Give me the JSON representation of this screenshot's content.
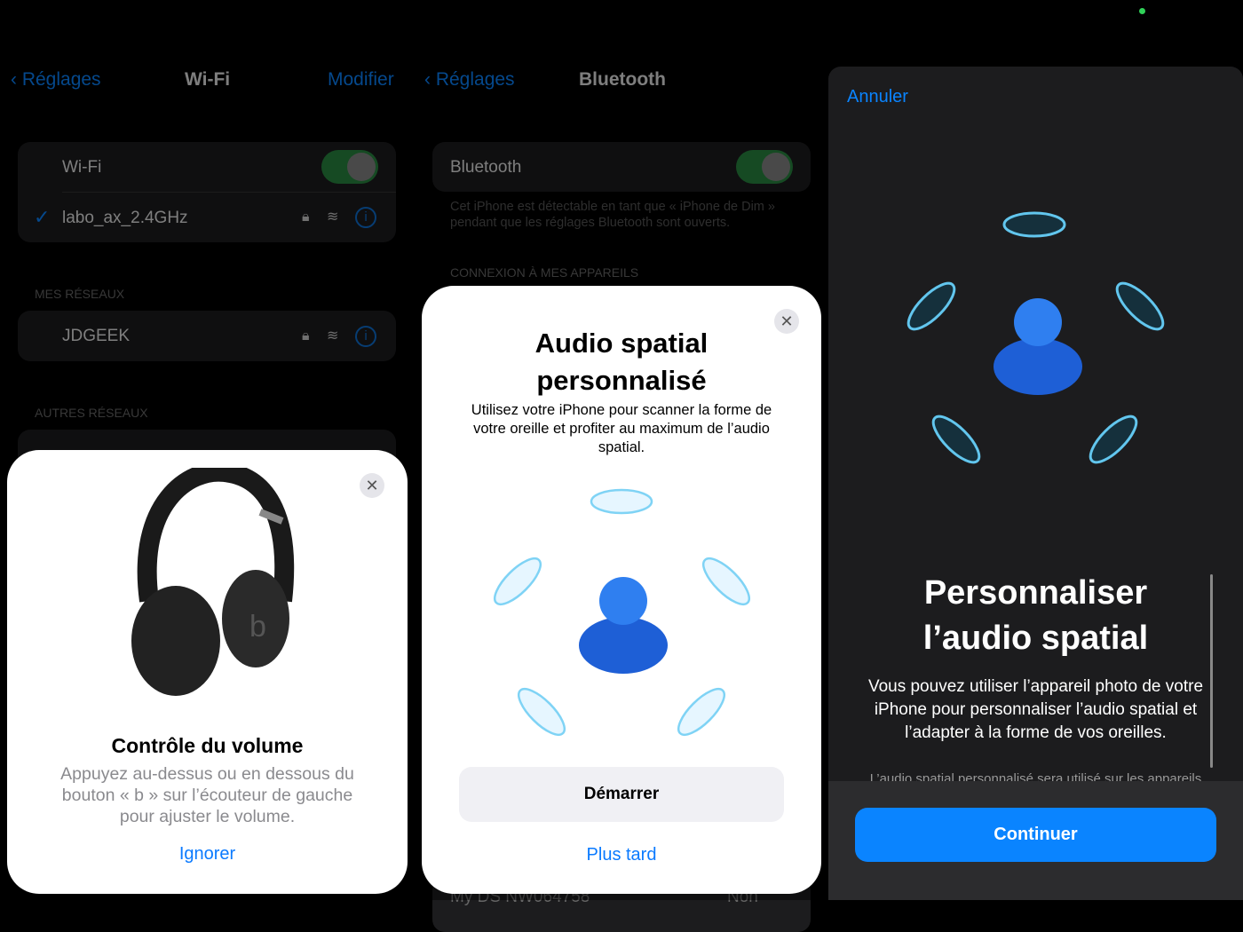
{
  "status": {
    "indicator_color": "#30d158"
  },
  "wifi_screen": {
    "back": "Réglages",
    "title": "Wi-Fi",
    "edit": "Modifier",
    "wifi_label": "Wi-Fi",
    "wifi_on": true,
    "connected": "labo_ax_2.4GHz",
    "my_networks_header": "MES RÉSEAUX",
    "my_networks": [
      "JDGEEK"
    ],
    "other_networks_header": "AUTRES RÉSEAUX"
  },
  "volume_card": {
    "title": "Contrôle du volume",
    "body": "Appuyez au-dessus ou en dessous du bouton « b » sur l’écouteur de gauche pour ajuster le volume.",
    "ignore": "Ignorer"
  },
  "bt_screen": {
    "back": "Réglages",
    "title": "Bluetooth",
    "bt_label": "Bluetooth",
    "bt_on": true,
    "desc": "Cet iPhone est détectable en tant que « iPhone de Dim » pendant que les réglages Bluetooth sont ouverts.",
    "section": "CONNEXION À MES APPAREILS",
    "device": "My DS NW064758",
    "device_status": "Non"
  },
  "spatial_card": {
    "title": "Audio spatial personnalisé",
    "body": "Utilisez votre iPhone pour scanner la forme de votre oreille et profiter au maximum de l’audio spatial.",
    "start": "Démarrer",
    "later": "Plus tard"
  },
  "personalize": {
    "cancel": "Annuler",
    "title": "Personnaliser l’audio spatial",
    "body": "Vous pouvez utiliser l’appareil photo de votre iPhone pour personnaliser l’audio spatial et l’adapter à la forme de vos oreilles.",
    "footnote": "L’audio spatial personnalisé sera utilisé sur les appareils",
    "continue": "Continuer"
  },
  "colors": {
    "accent": "#0a84ff",
    "toggle": "#30d158",
    "button": "#0a84ff"
  }
}
